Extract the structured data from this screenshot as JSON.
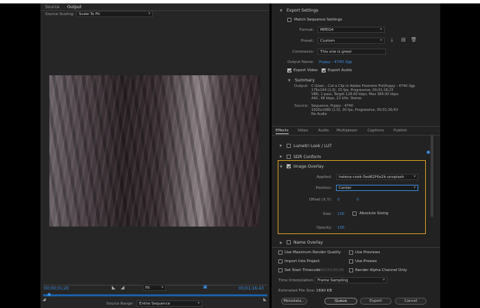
{
  "source_panel": {
    "tabs": [
      "Source",
      "Output"
    ],
    "source_scaling_label": "Source Scaling:",
    "source_scaling_value": "Scale To Fit",
    "timecode_in": "00;00;01;20",
    "timecode_out": "00;01;16;43",
    "fit_value": "Fit",
    "source_range_label": "Source Range:",
    "source_range_value": "Entire Sequence"
  },
  "export_settings": {
    "title": "Export Settings",
    "match_sequence_label": "Match Sequence Settings",
    "format_label": "Format:",
    "format_value": "MPEG4",
    "preset_label": "Preset:",
    "preset_value": "Custom",
    "comments_label": "Comments:",
    "comments_value": "This one is great",
    "output_name_label": "Output Name:",
    "output_name_value": "Puppy - 4740.3gp",
    "export_video_label": "Export Video",
    "export_audio_label": "Export Audio"
  },
  "summary": {
    "title": "Summary",
    "output_label": "Output:",
    "output_lines": [
      "C:\\User... Cut a Clip in Adobe Premiere Pro\\Puppy - 4740.3gp",
      "176x144 (1.0), 15 fps, Progressive, 00;01;16;25",
      "VBR, 1 pass, Target 128.00 kbps, Max 384.00 kbps",
      "AAC, 48 kbps, 22 kHz, Stereo"
    ],
    "source_label": "Source:",
    "source_lines": [
      "Sequence, Puppy - 4740",
      "1920x1080 (1.0), 30 fps, Progressive, 00;01;16;43",
      "No Audio"
    ]
  },
  "effects_tabs": [
    "Effects",
    "Video",
    "Audio",
    "Multiplexer",
    "Captions",
    "Publish"
  ],
  "effects": {
    "lumetri": "Lumetri Look / LUT",
    "sdr": "SDR Conform",
    "image_overlay": {
      "title": "Image Overlay",
      "applied_label": "Applied:",
      "applied_value": "helena-cook-5ed62Hle2k-unsplash",
      "position_label": "Position:",
      "position_value": "Center",
      "offset_label": "Offset (X,Y):",
      "offset_x": "0",
      "offset_y": "0",
      "size_label": "Size:",
      "size_value": "100",
      "absolute_sizing_label": "Absolute Sizing",
      "opacity_label": "Opacity:",
      "opacity_value": "100"
    },
    "name_overlay": "Name Overlay"
  },
  "render_options": {
    "max_render_quality": "Use Maximum Render Quality",
    "use_previews": "Use Previews",
    "import_into_project": "Import Into Project",
    "use_proxies": "Use Proxies",
    "set_start_timecode": "Set Start Timecode",
    "start_timecode_value": "00;00;00;00",
    "render_alpha": "Render Alpha Channel Only",
    "time_interp_label": "Time Interpolation:",
    "time_interp_value": "Frame Sampling",
    "est_size_label": "Estimated File Size:",
    "est_size_value": "1690 KB"
  },
  "buttons": {
    "metadata": "Metadata...",
    "queue": "Queue",
    "export": "Export",
    "cancel": "Cancel"
  },
  "colors": {
    "highlight": "#e0a51f",
    "accent_blue": "#3b8fe0"
  }
}
